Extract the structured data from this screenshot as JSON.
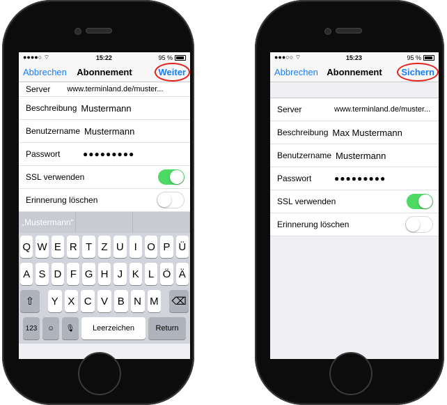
{
  "left": {
    "status": {
      "signal": "●●●●○",
      "time": "15:22",
      "battery": "95 %"
    },
    "nav": {
      "cancel": "Abbrechen",
      "title": "Abonnement",
      "action": "Weiter"
    },
    "fields": {
      "server_label": "Server",
      "server_value": "www.terminland.de/muster...",
      "beschreibung_label": "Beschreibung",
      "beschreibung_value": "Mustermann",
      "benutzer_label": "Benutzername",
      "benutzer_value": "Mustermann",
      "passwort_label": "Passwort",
      "passwort_value": "●●●●●●●●●",
      "ssl_label": "SSL verwenden",
      "erinnerung_label": "Erinnerung löschen"
    },
    "toggles": {
      "ssl": true,
      "erinnerung": false
    },
    "prediction": [
      "„Mustermann“",
      "",
      ""
    ],
    "keyboard": {
      "row1": [
        "Q",
        "W",
        "E",
        "R",
        "T",
        "Z",
        "U",
        "I",
        "O",
        "P",
        "Ü"
      ],
      "row2": [
        "A",
        "S",
        "D",
        "F",
        "G",
        "H",
        "J",
        "K",
        "L",
        "Ö",
        "Ä"
      ],
      "row3": [
        "Y",
        "X",
        "C",
        "V",
        "B",
        "N",
        "M"
      ],
      "numbers": "123",
      "space": "Leerzeichen",
      "return": "Return"
    }
  },
  "right": {
    "status": {
      "signal": "●●●○○",
      "time": "15:23",
      "battery": "95 %"
    },
    "nav": {
      "cancel": "Abbrechen",
      "title": "Abonnement",
      "action": "Sichern"
    },
    "fields": {
      "server_label": "Server",
      "server_value": "www.terminland.de/muster...",
      "beschreibung_label": "Beschreibung",
      "beschreibung_value": "Max Mustermann",
      "benutzer_label": "Benutzername",
      "benutzer_value": "Mustermann",
      "passwort_label": "Passwort",
      "passwort_value": "●●●●●●●●●",
      "ssl_label": "SSL verwenden",
      "erinnerung_label": "Erinnerung löschen"
    },
    "toggles": {
      "ssl": true,
      "erinnerung": false
    }
  },
  "colors": {
    "accent": "#157efb",
    "toggle_on": "#4cd964",
    "highlight_circle": "#e5231e"
  },
  "icons": {
    "shift": "shift-icon",
    "delete": "backspace-icon",
    "emoji": "emoji-icon",
    "mic": "microphone-icon",
    "wifi": "wifi-icon"
  }
}
